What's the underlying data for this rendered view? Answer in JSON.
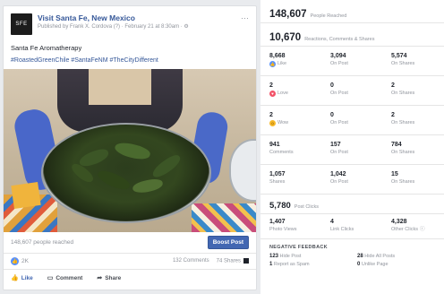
{
  "post": {
    "page_name": "Visit Santa Fe, New Mexico",
    "logo_text": "SFE",
    "published_line": "Published by Frank X. Cordova (?) · February 21 at 8:30am · ⚙",
    "more": "···",
    "text": "Santa Fe Aromatherapy",
    "hashtags": "#RoastedGreenChile #SantaFeNM #TheCityDifferent",
    "people_reached": "148,607 people reached",
    "boost_label": "Boost Post",
    "likes": "2K",
    "comments": "132 Comments",
    "shares": "74 Shares",
    "actions": {
      "like": "Like",
      "comment": "Comment",
      "share": "Share"
    }
  },
  "insights": {
    "reached": {
      "value": "148,607",
      "label": "People Reached"
    },
    "reactions": {
      "value": "10,670",
      "label": "Reactions, Comments & Shares"
    },
    "rows": [
      {
        "cells": [
          {
            "value": "8,668",
            "label": "Like",
            "icon": "like"
          },
          {
            "value": "3,094",
            "label": "On Post"
          },
          {
            "value": "5,574",
            "label": "On Shares"
          }
        ]
      },
      {
        "cells": [
          {
            "value": "2",
            "label": "Love",
            "icon": "love"
          },
          {
            "value": "0",
            "label": "On Post"
          },
          {
            "value": "2",
            "label": "On Shares"
          }
        ]
      },
      {
        "cells": [
          {
            "value": "2",
            "label": "Wow",
            "icon": "wow"
          },
          {
            "value": "0",
            "label": "On Post"
          },
          {
            "value": "2",
            "label": "On Shares"
          }
        ]
      },
      {
        "cells": [
          {
            "value": "941",
            "label": "Comments"
          },
          {
            "value": "157",
            "label": "On Post"
          },
          {
            "value": "784",
            "label": "On Shares"
          }
        ]
      },
      {
        "cells": [
          {
            "value": "1,057",
            "label": "Shares"
          },
          {
            "value": "1,042",
            "label": "On Post"
          },
          {
            "value": "15",
            "label": "On Shares"
          }
        ]
      }
    ],
    "clicks": {
      "value": "5,780",
      "label": "Post Clicks"
    },
    "click_row": [
      {
        "value": "1,407",
        "label": "Photo Views"
      },
      {
        "value": "4",
        "label": "Link Clicks"
      },
      {
        "value": "4,328",
        "label": "Other Clicks"
      }
    ],
    "negative": {
      "title": "NEGATIVE FEEDBACK",
      "items": [
        {
          "value": "123",
          "label": "Hide Post"
        },
        {
          "value": "28",
          "label": "Hide All Posts"
        },
        {
          "value": "1",
          "label": "Report as Spam"
        },
        {
          "value": "0",
          "label": "Unlike Page"
        }
      ]
    }
  },
  "colors": {
    "facebook_blue": "#4267b2",
    "link_blue": "#365899",
    "love": "#f25268",
    "wow": "#f7b928"
  }
}
